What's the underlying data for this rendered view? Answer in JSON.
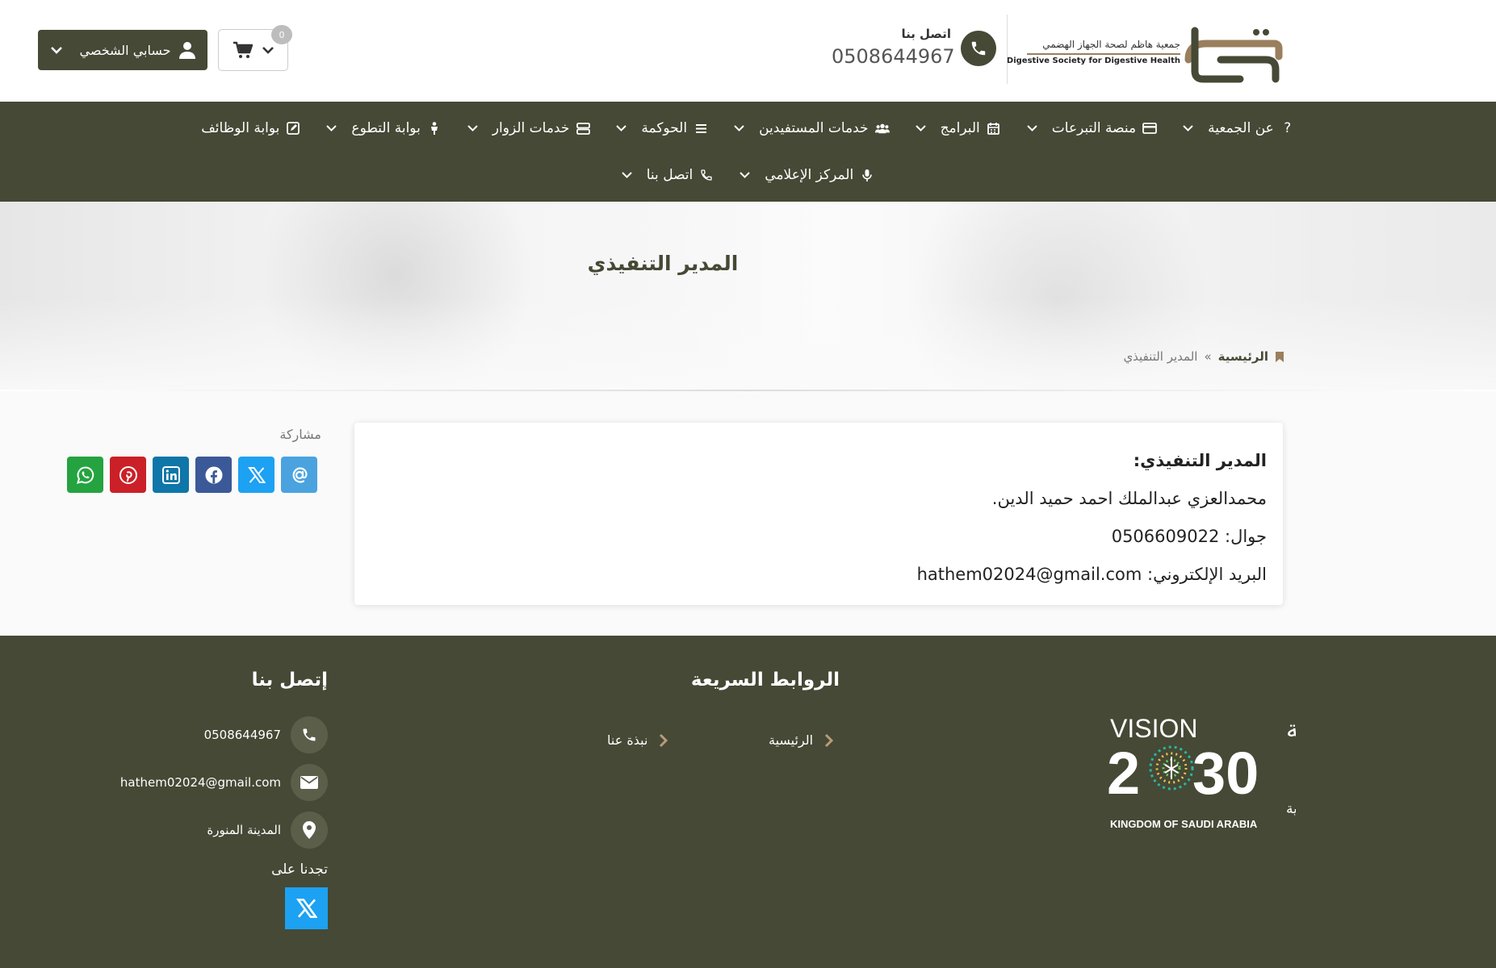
{
  "header": {
    "logo_arabic": "جمعية هاظم لصحة الجهاز الهضمي",
    "logo_english": "Digestive Society for Digestive Health",
    "contact_label": "اتصل بنا",
    "contact_number": "0508644967",
    "cart_count": "0",
    "account_label": "حسابي الشخصي"
  },
  "nav": {
    "row1": [
      {
        "label": "عن الجمعية",
        "icon": "question-icon"
      },
      {
        "label": "منصة التبرعات",
        "icon": "credit-card-icon"
      },
      {
        "label": "البرامج",
        "icon": "calendar-icon"
      },
      {
        "label": "خدمات المستفيدين",
        "icon": "users-icon"
      },
      {
        "label": "الحوكمة",
        "icon": "list-icon"
      },
      {
        "label": "خدمات الزوار",
        "icon": "server-icon"
      },
      {
        "label": "بوابة التطوع",
        "icon": "child-icon"
      },
      {
        "label": "بوابة الوظائف",
        "icon": "edit-icon"
      }
    ],
    "row2": [
      {
        "label": "المركز الإعلامي",
        "icon": "microphone-icon"
      },
      {
        "label": "اتصل بنا",
        "icon": "phone-icon"
      }
    ]
  },
  "hero": {
    "title": "المدير التنفيذي",
    "breadcrumb_home": "الرئيسية",
    "breadcrumb_separator": "»",
    "breadcrumb_current": "المدير التنفيذي"
  },
  "content": {
    "heading": "المدير التنفيذي:",
    "name": "محمدالعزي عبدالملك احمد حميد الدين.",
    "mobile": "جوال: 0506609022",
    "email": "البريد الإلكتروني: hathem02024@gmail.com"
  },
  "share": {
    "label": "مشاركة",
    "buttons": [
      {
        "icon": "email-icon",
        "color": "#4aa3df"
      },
      {
        "icon": "x-icon",
        "color": "#1da1f2"
      },
      {
        "icon": "facebook-icon",
        "color": "#3b5998"
      },
      {
        "icon": "linkedin-icon",
        "color": "#0e76a8"
      },
      {
        "icon": "pinterest-icon",
        "color": "#cb2027"
      },
      {
        "icon": "whatsapp-icon",
        "color": "#25a340"
      }
    ]
  },
  "footer": {
    "vision_text": "رؤيـــة",
    "vision_word": "VISION",
    "vision_year_left": "2",
    "vision_year_right": "30",
    "vision_kingdom_ar": "المملكة العربية السعودية",
    "vision_kingdom_en": "KINGDOM OF SAUDI ARABIA",
    "quick_links_title": "الروابط السريعة",
    "quick_links": [
      "الرئيسية",
      "نبذة عنا"
    ],
    "contact_title": "إتصل بنا",
    "phone": "0508644967",
    "email": "hathem02024@gmail.com",
    "city": "المدينة المنورة",
    "find_us": "تجدنا على"
  },
  "colors": {
    "brand": "#454935",
    "accent": "#9a7f5d",
    "twitter": "#1da1f2"
  }
}
